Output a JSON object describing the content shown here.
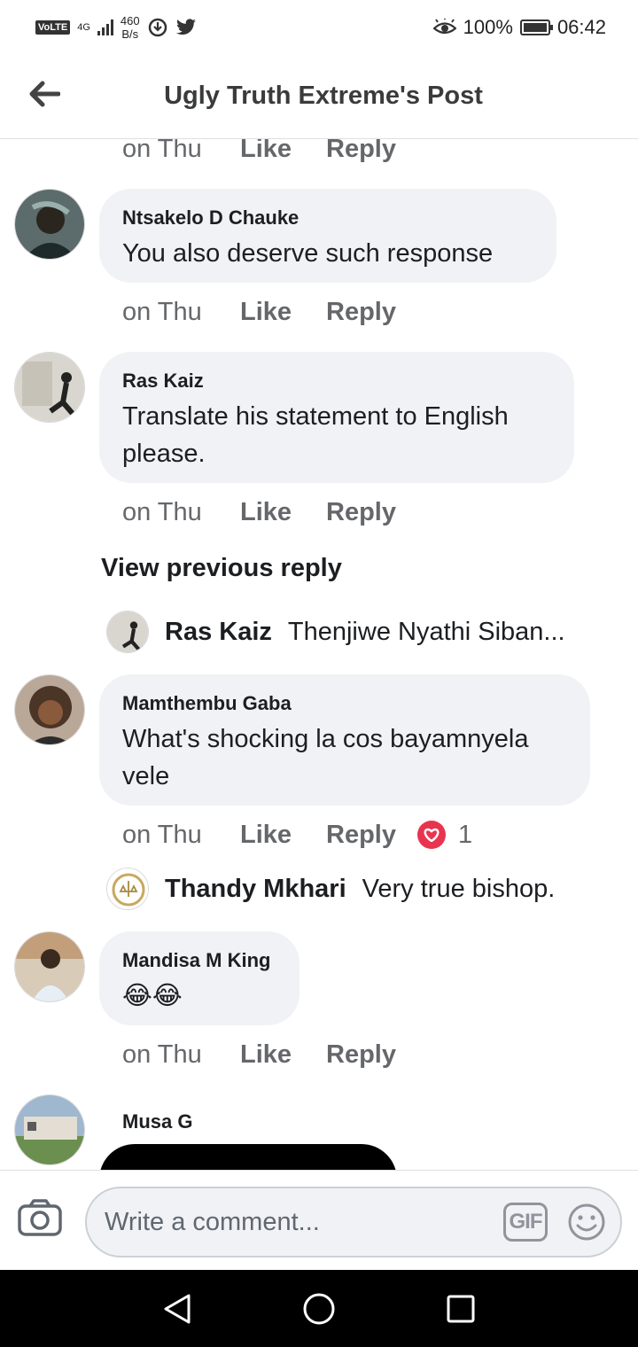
{
  "status_bar": {
    "volte": "VoLTE",
    "network": "4G",
    "speed_value": "460",
    "speed_unit": "B/s",
    "battery_percent": "100%",
    "time": "06:42",
    "battery_level": 1.0,
    "icons": [
      "volte-icon",
      "signal-icon",
      "data-saver-icon",
      "twitter-icon",
      "eye-comfort-icon",
      "battery-icon"
    ]
  },
  "header": {
    "title": "Ugly Truth Extreme's Post",
    "back_icon": "arrow-left-icon"
  },
  "actions": {
    "time": "on Thu",
    "like": "Like",
    "reply": "Reply"
  },
  "comments": [
    {
      "name": "Ntsakelo D Chauke",
      "text": "You also deserve such response"
    },
    {
      "name": "Ras Kaiz",
      "text": "Translate his statement to English please."
    },
    {
      "name": "Mamthembu Gaba",
      "text": "What's shocking la cos bayamnyela vele",
      "reactions": {
        "icon": "heart-icon",
        "count": "1"
      }
    },
    {
      "name": "Mandisa M King",
      "text": "😂😂"
    },
    {
      "name": "Musa G",
      "text": ""
    }
  ],
  "view_previous": "View previous reply",
  "reply_previews": [
    {
      "name": "Ras Kaiz",
      "text": "Thenjiwe Nyathi Siban..."
    },
    {
      "name": "Thandy Mkhari",
      "text": "Very true bishop."
    }
  ],
  "composer": {
    "placeholder": "Write a comment...",
    "gif_label": "GIF",
    "icons": [
      "camera-icon",
      "gif-icon",
      "smiley-icon"
    ]
  },
  "nav_bar": {
    "icons": [
      "back-triangle-icon",
      "home-circle-icon",
      "recents-square-icon"
    ]
  }
}
